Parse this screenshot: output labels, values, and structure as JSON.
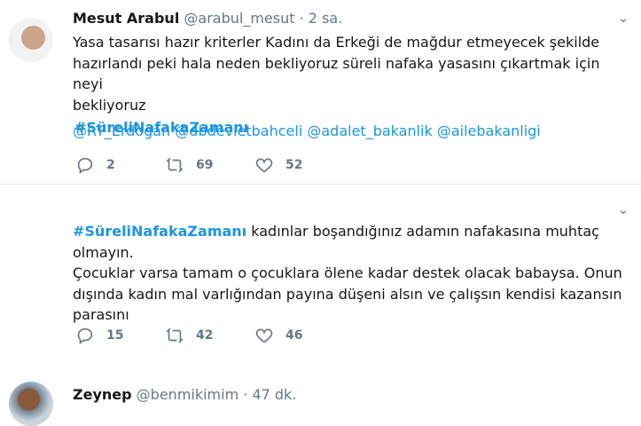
{
  "tweets": [
    {
      "name": "Mesut Arabul",
      "handle": "@arabul_mesut",
      "dot": "·",
      "time": "2 sa.",
      "text_lines": [
        "Yasa tasarısı hazır kriterler Kadını  da Erkeği de mağdur etmeyecek şekilde",
        "hazırlandı peki hala neden bekliyoruz süreli nafaka yasasını çıkartmak için neyi",
        "bekliyoruz"
      ],
      "hashtag": "#SüreliNafakaZamanı",
      "mentions": [
        "@RT_Erdogan",
        "@dbdevletbahceli",
        "@adalet_bakanlik",
        "@ailebakanligi"
      ],
      "actions": {
        "reply": "2",
        "retweet": "69",
        "like": "52"
      }
    },
    {
      "name": "Zeynep",
      "handle": "@benmikimim",
      "dot": "·",
      "time": "47 dk.",
      "hashtag": "#SüreliNafakaZamanı",
      "first_line_after": " kadınlar boşandığınız adamın nafakasına muhtaç olmayın.",
      "text_lines": [
        "Çocuklar varsa tamam o çocuklara ölene kadar destek olacak babaysa. Onun",
        "dışında kadın mal varlığından payına düşeni alsın ve çalışsın kendisi kazansın",
        "parasını"
      ],
      "actions": {
        "reply": "15",
        "retweet": "42",
        "like": "46"
      }
    }
  ],
  "icons": {
    "reply": "reply-icon",
    "retweet": "retweet-icon",
    "like": "heart-icon",
    "more": "chevron-down-icon"
  },
  "colors": {
    "link": "#1b95e0",
    "muted": "#657786",
    "text": "#14171a",
    "divider": "#e6ecf0"
  }
}
